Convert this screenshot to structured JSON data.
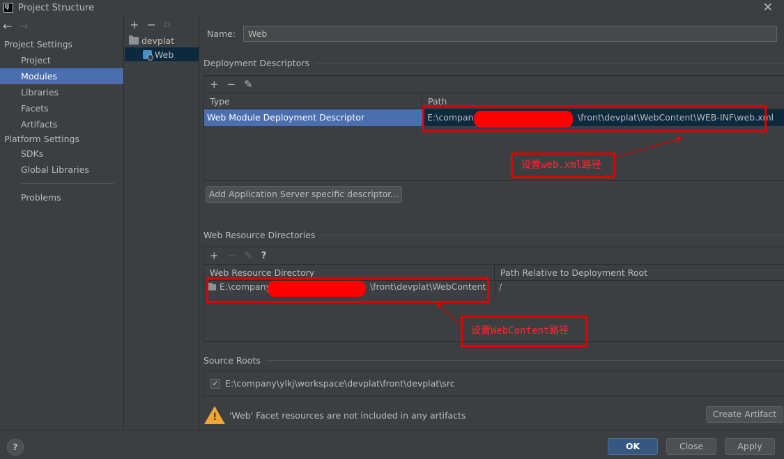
{
  "window": {
    "title": "Project Structure",
    "close_glyph": "✕",
    "logo_text": "IJ"
  },
  "nav": {
    "back_glyph": "←",
    "forward_glyph": "→",
    "project_settings": "Project Settings",
    "project": "Project",
    "modules": "Modules",
    "libraries": "Libraries",
    "facets": "Facets",
    "artifacts": "Artifacts",
    "platform_settings": "Platform Settings",
    "sdks": "SDKs",
    "global_libraries": "Global Libraries",
    "problems": "Problems"
  },
  "tree": {
    "add": "+",
    "remove": "−",
    "copy": "⧉",
    "root": "devplat",
    "child": "Web"
  },
  "module": {
    "name_label": "Name:",
    "name_value": "Web"
  },
  "descriptors": {
    "section_title": "Deployment Descriptors",
    "add": "+",
    "remove": "−",
    "edit": "✎",
    "col_type": "Type",
    "col_path": "Path",
    "row_type": "Web Module Deployment Descriptor",
    "row_path_prefix": "E:\\company",
    "row_path_suffix": "\\front\\devplat\\WebContent\\WEB-INF\\web.xml",
    "add_server_button": "Add Application Server specific descriptor...",
    "annotation": "设置web.xml路径"
  },
  "resources": {
    "section_title": "Web Resource Directories",
    "add": "+",
    "remove": "−",
    "edit": "✎",
    "help": "?",
    "col_dir": "Web Resource Directory",
    "col_rel": "Path Relative to Deployment Root",
    "row_dir_prefix": "E:\\company",
    "row_dir_suffix": "\\front\\devplat\\WebContent",
    "row_rel": "/",
    "annotation": "设置WebContent路径"
  },
  "source_roots": {
    "section_title": "Source Roots",
    "checkmark": "✓",
    "path": "E:\\company\\ylkj\\workspace\\devplat\\front\\devplat\\src"
  },
  "warning": {
    "glyph": "!",
    "text": "'Web' Facet resources are not included in any artifacts",
    "create_artifact": "Create Artifact"
  },
  "footer": {
    "help": "?",
    "ok": "OK",
    "close": "Close",
    "apply": "Apply"
  },
  "colors": {
    "background": "#3c3f41",
    "selection": "#4b6eaf",
    "annotation_red": "#ff0000",
    "warning": "#f0a732"
  }
}
